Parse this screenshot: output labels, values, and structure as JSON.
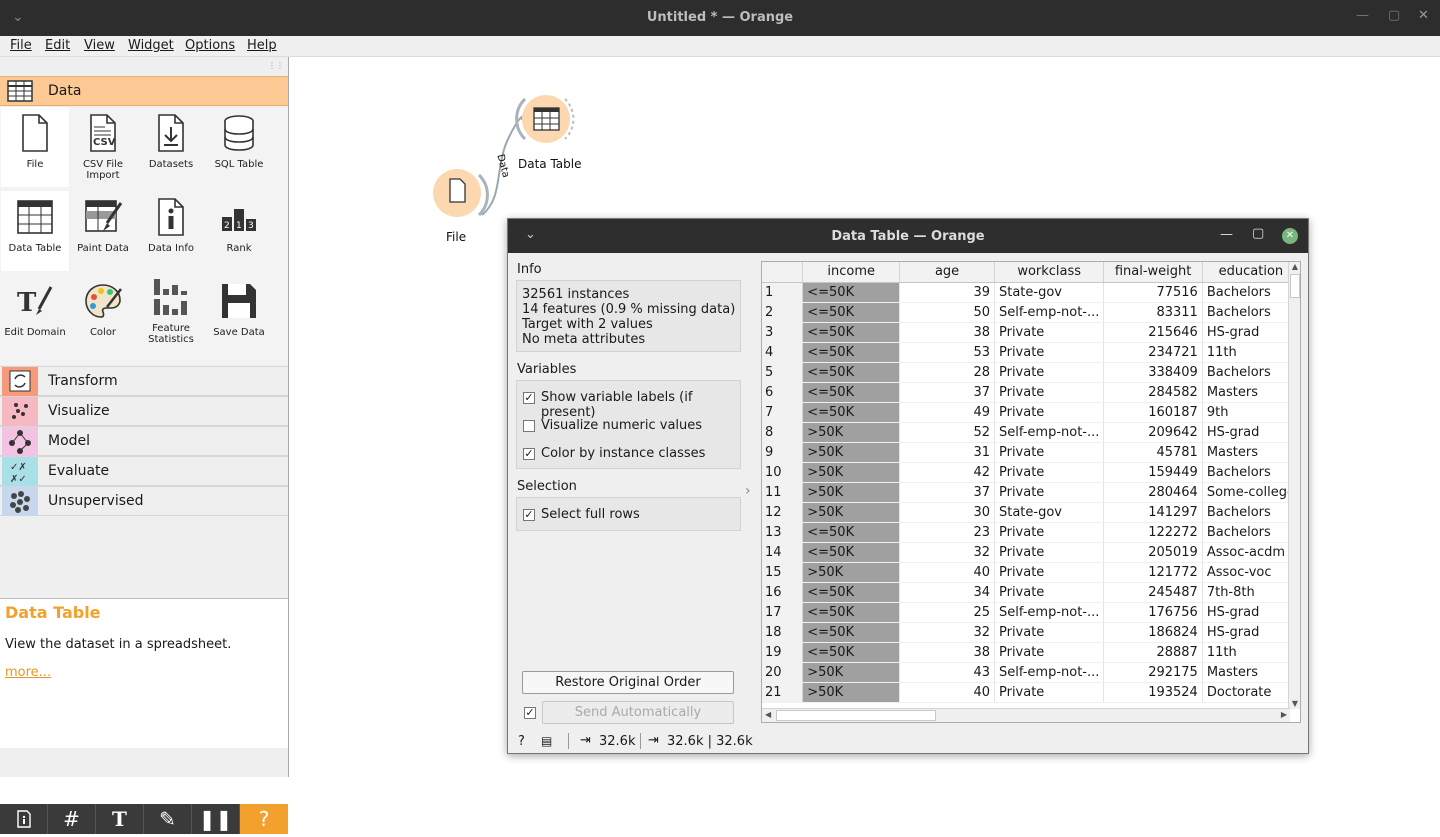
{
  "window": {
    "title": "Untitled * — Orange"
  },
  "menu": [
    {
      "label": "File"
    },
    {
      "label": "Edit"
    },
    {
      "label": "View"
    },
    {
      "label": "Widget"
    },
    {
      "label": "Options"
    },
    {
      "label": "Help"
    }
  ],
  "toolbox": {
    "data_category": "Data",
    "widgets": [
      {
        "label": "File",
        "icon": "file-icon"
      },
      {
        "label": "CSV File Import",
        "icon": "csv-file-icon"
      },
      {
        "label": "Datasets",
        "icon": "datasets-download-icon"
      },
      {
        "label": "SQL Table",
        "icon": "database-icon"
      },
      {
        "label": "Data Table",
        "icon": "table-icon"
      },
      {
        "label": "Paint Data",
        "icon": "paint-brush-icon"
      },
      {
        "label": "Data Info",
        "icon": "info-icon"
      },
      {
        "label": "Rank",
        "icon": "rank-icon"
      },
      {
        "label": "Edit Domain",
        "icon": "edit-domain-icon"
      },
      {
        "label": "Color",
        "icon": "palette-icon"
      },
      {
        "label": "Feature Statistics",
        "icon": "bar-statistics-icon"
      },
      {
        "label": "Save Data",
        "icon": "floppy-disk-icon"
      }
    ],
    "categories": [
      {
        "label": "Transform",
        "color": "#f59a7a"
      },
      {
        "label": "Visualize",
        "color": "#f6b9c2"
      },
      {
        "label": "Model",
        "color": "#f2c3e3"
      },
      {
        "label": "Evaluate",
        "color": "#a9e0e8"
      },
      {
        "label": "Unsupervised",
        "color": "#c7d7ee"
      }
    ],
    "data_color": "#fcc994"
  },
  "help": {
    "title": "Data Table",
    "description": "View the dataset in a spreadsheet.",
    "more": "more..."
  },
  "canvas": {
    "file_node": "File",
    "table_node": "Data Table",
    "link_label": "Data"
  },
  "data_table_window": {
    "title": "Data Table — Orange",
    "info_title": "Info",
    "info_lines": [
      "32561 instances",
      "14 features (0.9 % missing data)",
      "Target with 2 values",
      "No meta attributes"
    ],
    "variables_title": "Variables",
    "options": [
      {
        "label": "Show variable labels (if present)",
        "checked": "✓"
      },
      {
        "label": "Visualize numeric values",
        "checked": ""
      },
      {
        "label": "Color by instance classes",
        "checked": "✓"
      }
    ],
    "selection_title": "Selection",
    "select_full_rows": {
      "label": "Select full rows",
      "checked": "✓"
    },
    "restore_button": "Restore Original Order",
    "send_button": "Send Automatically",
    "send_checked": "✓",
    "status": {
      "input": "32.6k",
      "output": "32.6k | 32.6k"
    },
    "columns": [
      "income",
      "age",
      "workclass",
      "final-weight",
      "education"
    ],
    "rows": [
      [
        "1",
        "<=50K",
        "39",
        "State-gov",
        "77516",
        "Bachelors"
      ],
      [
        "2",
        "<=50K",
        "50",
        "Self-emp-not-...",
        "83311",
        "Bachelors"
      ],
      [
        "3",
        "<=50K",
        "38",
        "Private",
        "215646",
        "HS-grad"
      ],
      [
        "4",
        "<=50K",
        "53",
        "Private",
        "234721",
        "11th"
      ],
      [
        "5",
        "<=50K",
        "28",
        "Private",
        "338409",
        "Bachelors"
      ],
      [
        "6",
        "<=50K",
        "37",
        "Private",
        "284582",
        "Masters"
      ],
      [
        "7",
        "<=50K",
        "49",
        "Private",
        "160187",
        "9th"
      ],
      [
        "8",
        ">50K",
        "52",
        "Self-emp-not-...",
        "209642",
        "HS-grad"
      ],
      [
        "9",
        ">50K",
        "31",
        "Private",
        "45781",
        "Masters"
      ],
      [
        "10",
        ">50K",
        "42",
        "Private",
        "159449",
        "Bachelors"
      ],
      [
        "11",
        ">50K",
        "37",
        "Private",
        "280464",
        "Some-college"
      ],
      [
        "12",
        ">50K",
        "30",
        "State-gov",
        "141297",
        "Bachelors"
      ],
      [
        "13",
        "<=50K",
        "23",
        "Private",
        "122272",
        "Bachelors"
      ],
      [
        "14",
        "<=50K",
        "32",
        "Private",
        "205019",
        "Assoc-acdm"
      ],
      [
        "15",
        ">50K",
        "40",
        "Private",
        "121772",
        "Assoc-voc"
      ],
      [
        "16",
        "<=50K",
        "34",
        "Private",
        "245487",
        "7th-8th"
      ],
      [
        "17",
        "<=50K",
        "25",
        "Self-emp-not-...",
        "176756",
        "HS-grad"
      ],
      [
        "18",
        "<=50K",
        "32",
        "Private",
        "186824",
        "HS-grad"
      ],
      [
        "19",
        "<=50K",
        "38",
        "Private",
        "28887",
        "11th"
      ],
      [
        "20",
        ">50K",
        "43",
        "Self-emp-not-...",
        "292175",
        "Masters"
      ],
      [
        "21",
        ">50K",
        "40",
        "Private",
        "193524",
        "Doctorate"
      ]
    ]
  },
  "colors": {
    "accent_orange": "#f2a12c",
    "node_fill": "#fcd8b0",
    "income_cell": "#a0a0a0",
    "titlebar": "#2d2d2d"
  }
}
